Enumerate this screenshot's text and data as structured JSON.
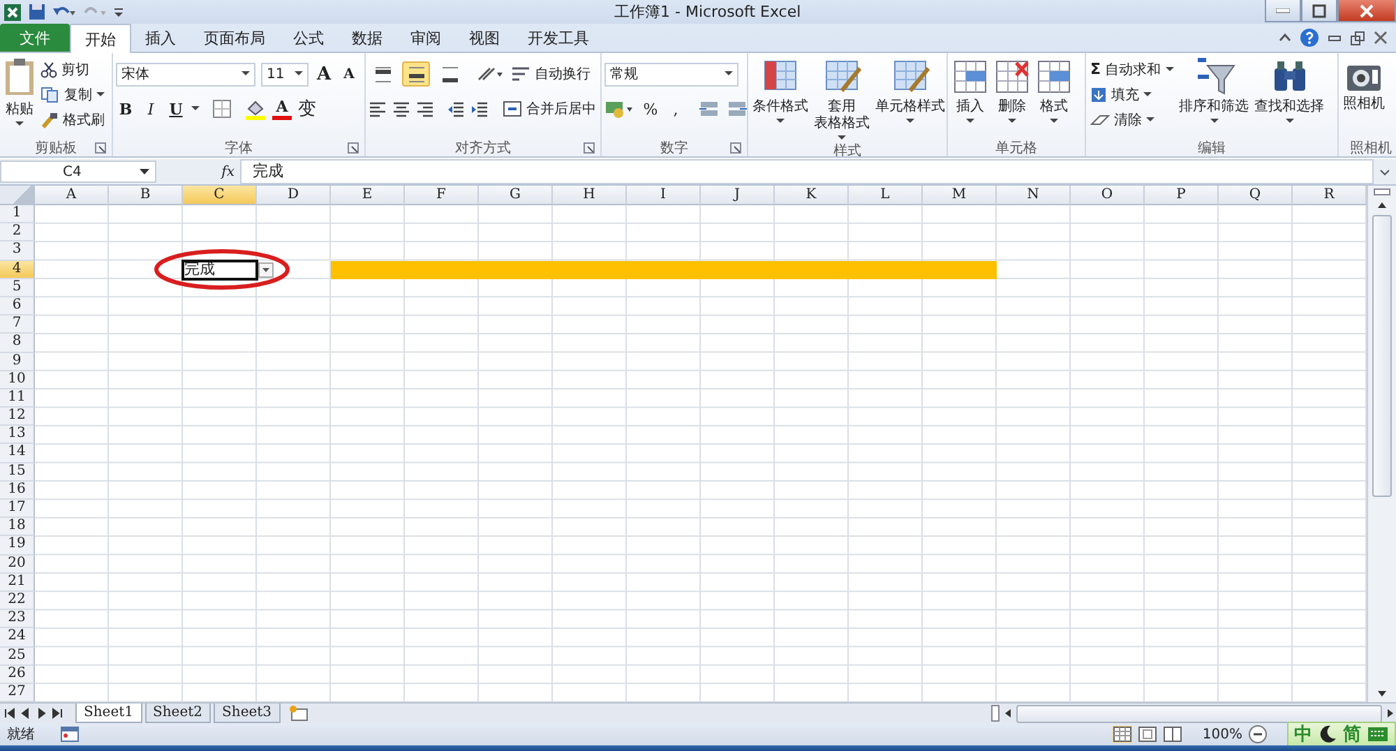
{
  "window": {
    "title": "工作簿1 - Microsoft Excel"
  },
  "tabs": [
    {
      "label": "文件",
      "kind": "file",
      "selected": false
    },
    {
      "label": "开始",
      "kind": "tab",
      "selected": true
    },
    {
      "label": "插入",
      "kind": "tab",
      "selected": false
    },
    {
      "label": "页面布局",
      "kind": "tab",
      "selected": false
    },
    {
      "label": "公式",
      "kind": "tab",
      "selected": false
    },
    {
      "label": "数据",
      "kind": "tab",
      "selected": false
    },
    {
      "label": "审阅",
      "kind": "tab",
      "selected": false
    },
    {
      "label": "视图",
      "kind": "tab",
      "selected": false
    },
    {
      "label": "开发工具",
      "kind": "tab",
      "selected": false
    }
  ],
  "ribbon": [
    {
      "kind": "clipboard",
      "label": "剪贴板",
      "launcher": true,
      "large": {
        "label": "粘贴",
        "dropdown": true
      },
      "small": [
        {
          "label": "剪切",
          "dropdown": false
        },
        {
          "label": "复制",
          "dropdown": true
        },
        {
          "label": "格式刷",
          "dropdown": false
        }
      ]
    },
    {
      "kind": "font",
      "label": "字体",
      "launcher": true,
      "font": "宋体",
      "size": "11",
      "grow": "A",
      "shrink": "A",
      "bold": "B",
      "italic": "I",
      "underline": "U",
      "font_color": "A",
      "phonetic": "变"
    },
    {
      "kind": "align",
      "label": "对齐方式",
      "launcher": true,
      "vertical": [
        {
          "selected": false
        },
        {
          "selected": true
        },
        {
          "selected": false
        }
      ],
      "wrap": "自动换行",
      "merge": "合并后居中"
    },
    {
      "kind": "number",
      "label": "数字",
      "launcher": true,
      "format": "常规",
      "percent": "%",
      "comma": ","
    },
    {
      "kind": "large",
      "label": "样式",
      "launcher": false,
      "buttons": [
        {
          "lines": [
            "条件格式"
          ],
          "dropdown": true
        },
        {
          "lines": [
            "套用",
            "表格格式"
          ],
          "dropdown": true
        },
        {
          "lines": [
            "单元格样式"
          ],
          "dropdown": true
        }
      ]
    },
    {
      "kind": "cells",
      "label": "单元格",
      "launcher": false,
      "buttons": [
        {
          "lines": [
            "插入"
          ],
          "dropdown": true
        },
        {
          "lines": [
            "删除"
          ],
          "dropdown": true
        },
        {
          "lines": [
            "格式"
          ],
          "dropdown": true
        }
      ]
    },
    {
      "kind": "editing",
      "label": "编辑",
      "launcher": false,
      "small": [
        {
          "glyph": "Σ",
          "label": "自动求和",
          "dropdown": true
        },
        {
          "label": "填充",
          "dropdown": true
        },
        {
          "label": "清除",
          "dropdown": true
        }
      ],
      "buttons": [
        {
          "lines": [
            "排序和筛选"
          ],
          "dropdown": true
        },
        {
          "lines": [
            "查找和选择"
          ],
          "dropdown": true
        }
      ]
    },
    {
      "kind": "camera",
      "label": "照相机",
      "launcher": false,
      "buttons": [
        {
          "lines": [
            "照相机"
          ],
          "dropdown": false
        }
      ]
    }
  ],
  "formula_bar": {
    "name_box": "C4",
    "fx": "fx",
    "value": "完成"
  },
  "sheet": {
    "columns": [
      {
        "label": "A",
        "selected": false
      },
      {
        "label": "B",
        "selected": false
      },
      {
        "label": "C",
        "selected": true
      },
      {
        "label": "D",
        "selected": false
      },
      {
        "label": "E",
        "selected": false
      },
      {
        "label": "F",
        "selected": false
      },
      {
        "label": "G",
        "selected": false
      },
      {
        "label": "H",
        "selected": false
      },
      {
        "label": "I",
        "selected": false
      },
      {
        "label": "J",
        "selected": false
      },
      {
        "label": "K",
        "selected": false
      },
      {
        "label": "L",
        "selected": false
      },
      {
        "label": "M",
        "selected": false
      },
      {
        "label": "N",
        "selected": false
      },
      {
        "label": "O",
        "selected": false
      },
      {
        "label": "P",
        "selected": false
      },
      {
        "label": "Q",
        "selected": false
      },
      {
        "label": "R",
        "selected": false
      }
    ],
    "rows": [
      {
        "label": "1",
        "selected": false
      },
      {
        "label": "2",
        "selected": false
      },
      {
        "label": "3",
        "selected": false
      },
      {
        "label": "4",
        "selected": true,
        "cells": [
          null,
          null,
          {
            "value": "完成",
            "active": true,
            "dropdown": true,
            "circled": true
          },
          null,
          {
            "color": "#ffc000"
          },
          {
            "color": "#ffc000"
          },
          {
            "color": "#ffc000"
          },
          {
            "color": "#ffc000"
          },
          {
            "color": "#ffc000"
          },
          {
            "color": "#ffc000"
          },
          {
            "color": "#ffc000"
          },
          {
            "color": "#ffc000"
          },
          {
            "color": "#ffc000"
          }
        ]
      },
      {
        "label": "5",
        "selected": false
      },
      {
        "label": "6",
        "selected": false
      },
      {
        "label": "7",
        "selected": false
      },
      {
        "label": "8",
        "selected": false
      },
      {
        "label": "9",
        "selected": false
      },
      {
        "label": "10",
        "selected": false
      },
      {
        "label": "11",
        "selected": false
      },
      {
        "label": "12",
        "selected": false
      },
      {
        "label": "13",
        "selected": false
      },
      {
        "label": "14",
        "selected": false
      },
      {
        "label": "15",
        "selected": false
      },
      {
        "label": "16",
        "selected": false
      },
      {
        "label": "17",
        "selected": false
      },
      {
        "label": "18",
        "selected": false
      },
      {
        "label": "19",
        "selected": false
      },
      {
        "label": "20",
        "selected": false
      },
      {
        "label": "21",
        "selected": false
      },
      {
        "label": "22",
        "selected": false
      },
      {
        "label": "23",
        "selected": false
      },
      {
        "label": "24",
        "selected": false
      },
      {
        "label": "25",
        "selected": false
      },
      {
        "label": "26",
        "selected": false
      },
      {
        "label": "27",
        "selected": false
      }
    ]
  },
  "sheet_tabs": [
    {
      "label": "Sheet1",
      "selected": true
    },
    {
      "label": "Sheet2",
      "selected": false
    },
    {
      "label": "Sheet3",
      "selected": false
    }
  ],
  "status_bar": {
    "status": "就绪",
    "zoom": "100%"
  },
  "ime": {
    "mode": "中",
    "script": "简"
  }
}
